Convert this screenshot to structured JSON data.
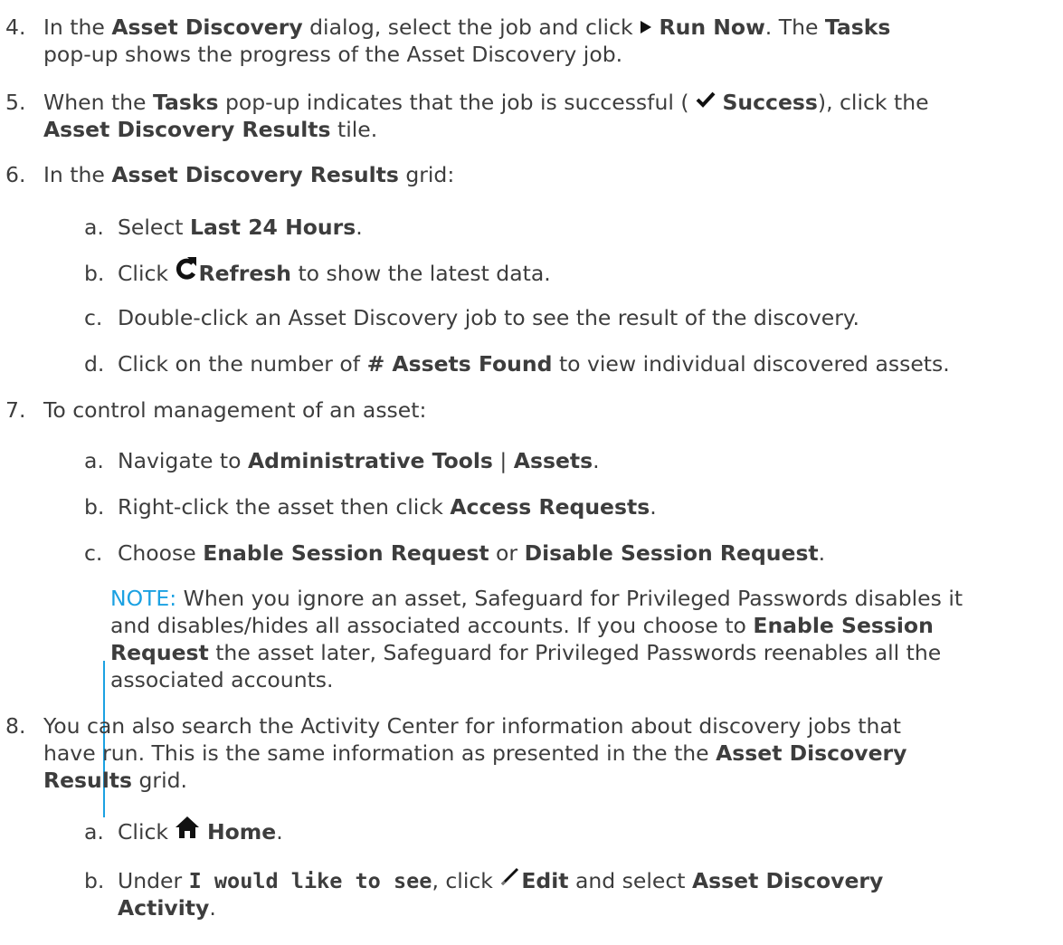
{
  "step4": {
    "num": "4.",
    "t1": "In the ",
    "b1": "Asset Discovery",
    "t2": " dialog, select the job and click ",
    "b2": "Run Now",
    "t3": ". The ",
    "b3": "Tasks",
    "t4": "pop-up shows the progress of the Asset Discovery job.",
    "icon": "play-icon"
  },
  "step5": {
    "num": "5.",
    "t1": "When the ",
    "b1": "Tasks",
    "t2": " pop-up indicates that the job is successful ( ",
    "b2": "Success",
    "t3": "), click the",
    "b3": "Asset Discovery Results",
    "t4": " tile.",
    "icon": "checkmark-icon"
  },
  "step6": {
    "num": "6.",
    "t1": "In the ",
    "b1": "Asset Discovery Results",
    "t2": " grid:",
    "a": {
      "num": "a.",
      "t1": "Select ",
      "b1": "Last 24 Hours",
      "t2": "."
    },
    "b": {
      "num": "b.",
      "t1": "Click ",
      "b1": "Refresh",
      "t2": " to show the latest data.",
      "icon": "refresh-icon"
    },
    "c": {
      "num": "c.",
      "t1": "Double-click an Asset Discovery job to see the result of the discovery."
    },
    "d": {
      "num": "d.",
      "t1": "Click on the number of ",
      "b1": "# Assets Found",
      "t2": " to view individual discovered assets."
    }
  },
  "step7": {
    "num": "7.",
    "t1": "To control management of an asset:",
    "a": {
      "num": "a.",
      "t1": "Navigate to ",
      "b1": "Administrative Tools",
      "t2": " | ",
      "b2": "Assets",
      "t3": "."
    },
    "b": {
      "num": "b.",
      "t1": "Right-click the asset then click ",
      "b1": "Access Requests",
      "t2": "."
    },
    "c": {
      "num": "c.",
      "t1": "Choose ",
      "b1": "Enable Session Request",
      "t2": " or ",
      "b2": "Disable Session Request",
      "t3": "."
    }
  },
  "note": {
    "label": "NOTE:",
    "l1": " When you ignore an asset, Safeguard for Privileged Passwords disables it",
    "l2a": "and disables/hides all associated accounts. If you choose to ",
    "l2b": "Enable Session",
    "l3a": "Request",
    "l3b": " the asset later, Safeguard for Privileged Passwords reenables all the",
    "l4": "associated accounts.",
    "accent_color": "#1ba1e2"
  },
  "step8": {
    "num": "8.",
    "l1": "You can also search the Activity Center for information about discovery jobs that",
    "l2a": "have run. This is the same information as presented in the the ",
    "l2b": "Asset Discovery",
    "l3a": "Results",
    "l3b": " grid.",
    "a": {
      "num": "a.",
      "t1": "Click ",
      "b1": "Home",
      "t2": ".",
      "icon": "home-icon"
    },
    "b": {
      "num": "b.",
      "t1": "Under ",
      "b1": "I would like to see",
      "t2": ", click ",
      "b2": "Edit",
      "t3": " and select ",
      "b3": "Asset Discovery",
      "b4": "Activity",
      "t4": ".",
      "icon": "pencil-icon"
    }
  }
}
